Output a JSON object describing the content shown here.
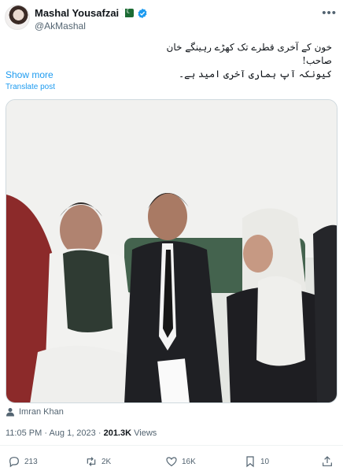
{
  "author": {
    "name": "Mashal Yousafzai",
    "handle": "@AkMashal",
    "avatar_icon": "profile-photo",
    "flag_icon": "pakistan-flag-icon",
    "verified_color": "#1d9bf0"
  },
  "tweet": {
    "text_line1": "خون کے آخری قطرے تک کھڑے رہینگے خان صاحب!",
    "text_line2": "کیونکہ آپ ہماری آخری امید ہے۔",
    "show_more_label": "Show more",
    "translate_label": "Translate post"
  },
  "media": {
    "tagged_user": "Imran Khan"
  },
  "meta": {
    "time": "11:05 PM",
    "separator": " · ",
    "date": "Aug 1, 2023",
    "views_count": "201.3K",
    "views_label": "Views"
  },
  "actions": {
    "replies": "213",
    "reposts": "2K",
    "likes": "16K",
    "bookmarks": "10"
  },
  "colors": {
    "accent": "#1d9bf0",
    "secondary_text": "#536471"
  }
}
